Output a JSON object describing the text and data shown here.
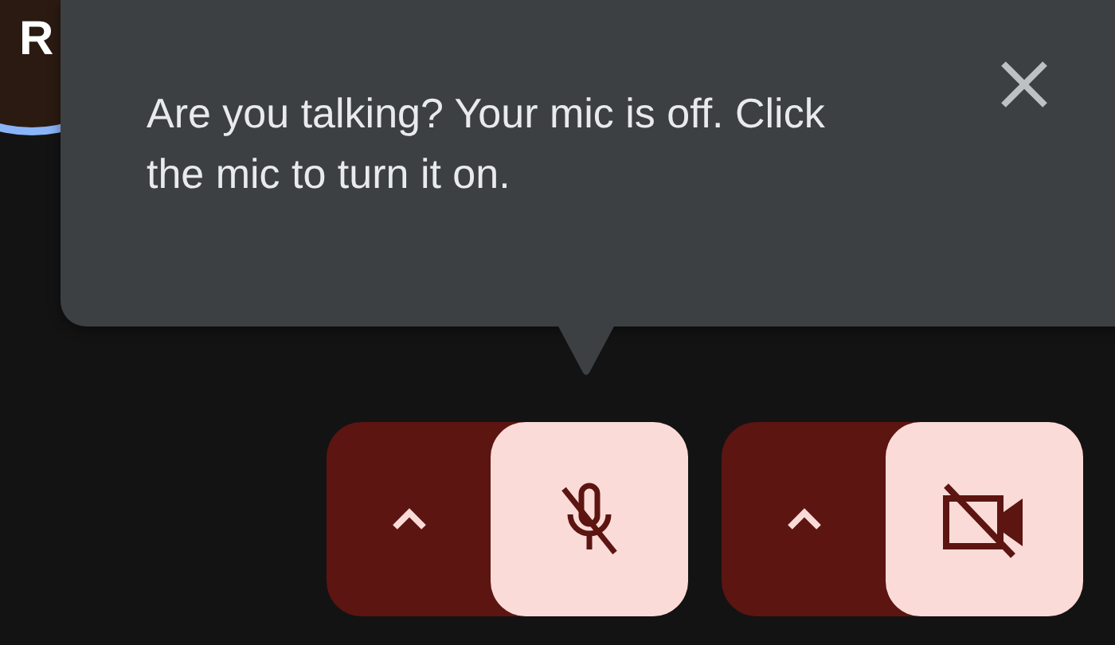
{
  "participant": {
    "initial": "R"
  },
  "tooltip": {
    "message": "Are you talking? Your mic is off. Click the mic to turn it on."
  },
  "controls": [
    {
      "kind": "mic",
      "on": false
    },
    {
      "kind": "camera",
      "on": false
    }
  ]
}
